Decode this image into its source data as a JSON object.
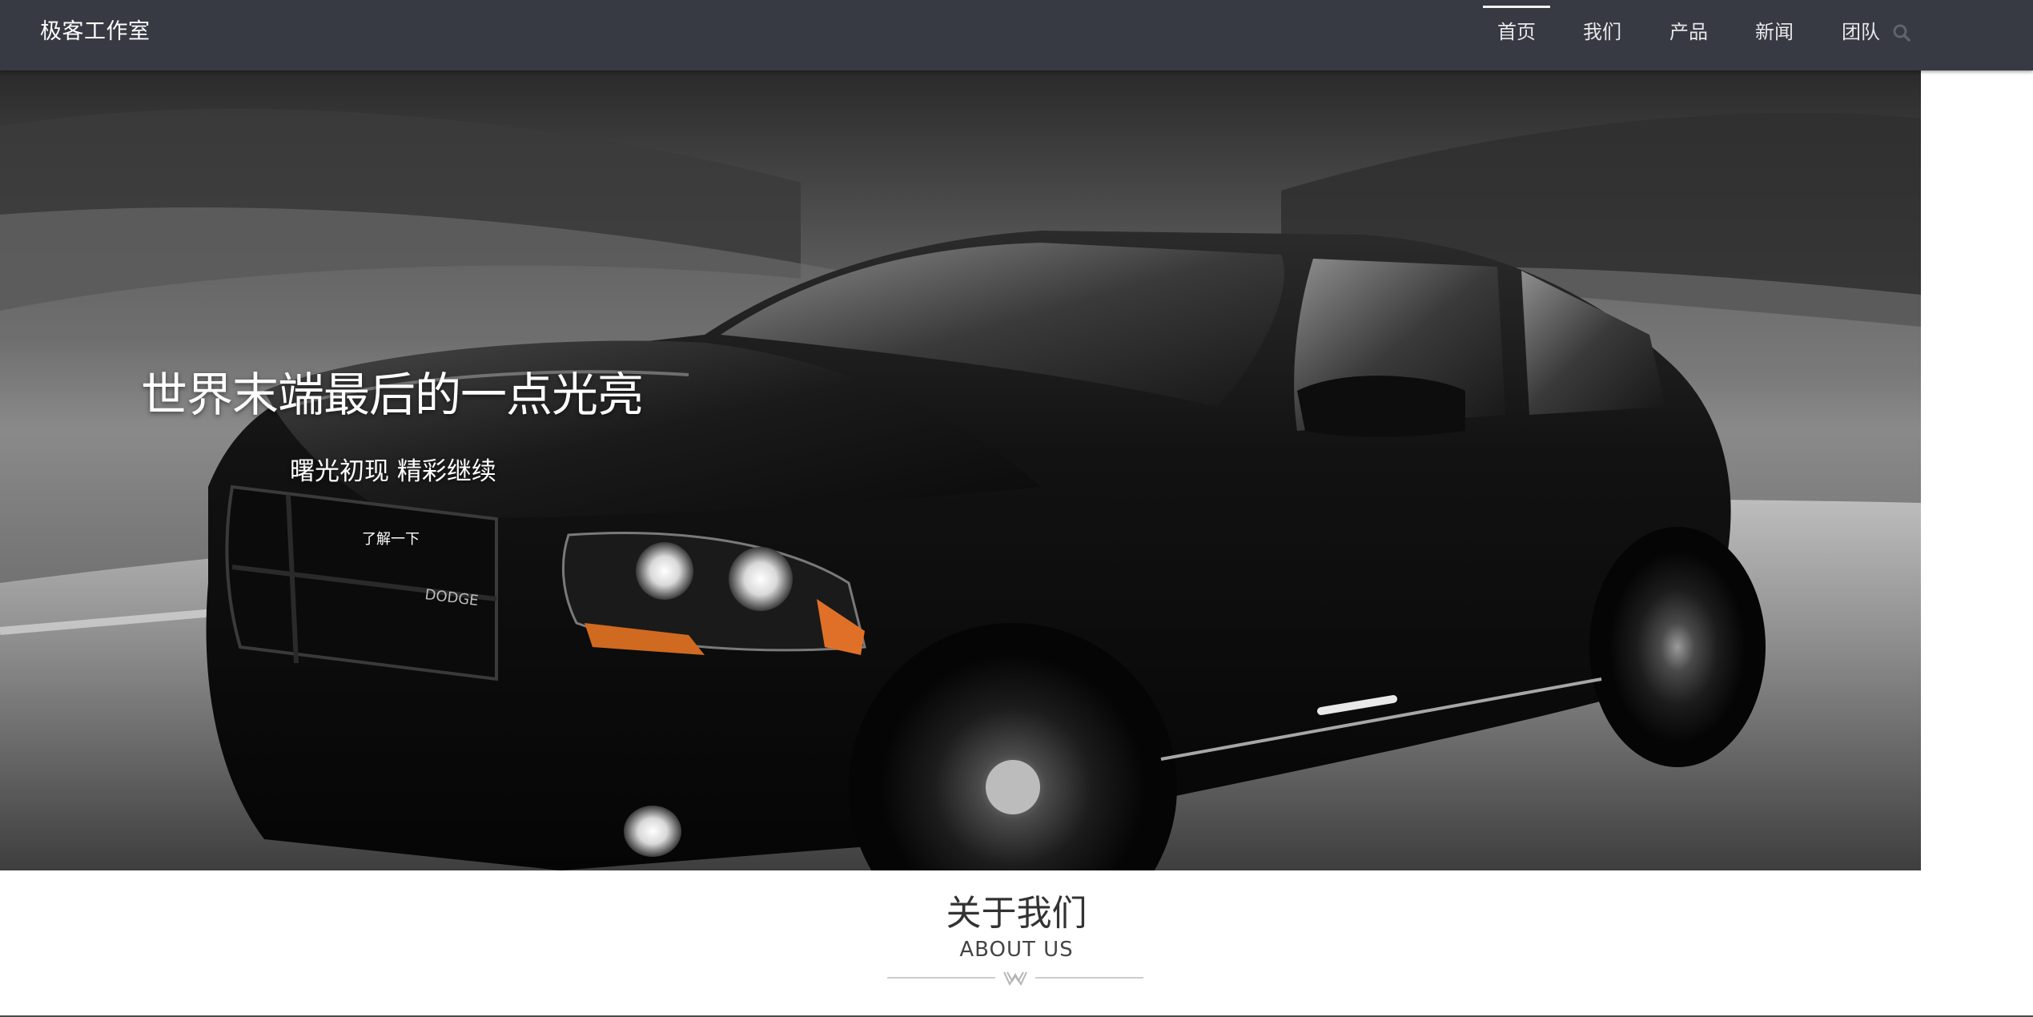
{
  "header": {
    "brand": "极客工作室",
    "nav": [
      {
        "label": "首页",
        "active": true
      },
      {
        "label": "我们",
        "active": false
      },
      {
        "label": "产品",
        "active": false
      },
      {
        "label": "新闻",
        "active": false
      },
      {
        "label": "团队",
        "active": false
      }
    ],
    "search_icon": "search-icon"
  },
  "hero": {
    "title": "世界末端最后的一点光亮",
    "subtitle": "曙光初现 精彩继续",
    "button_label": "了解一下",
    "car_badge": "DODGE"
  },
  "about": {
    "title": "关于我们",
    "subtitle": "ABOUT US",
    "divider_icon": "w-ornament-icon"
  },
  "colors": {
    "navbar_bg": "#373a43",
    "nav_text": "#e8e8ea",
    "button_bg": "#0b0b0b",
    "heading_text": "#333333"
  }
}
